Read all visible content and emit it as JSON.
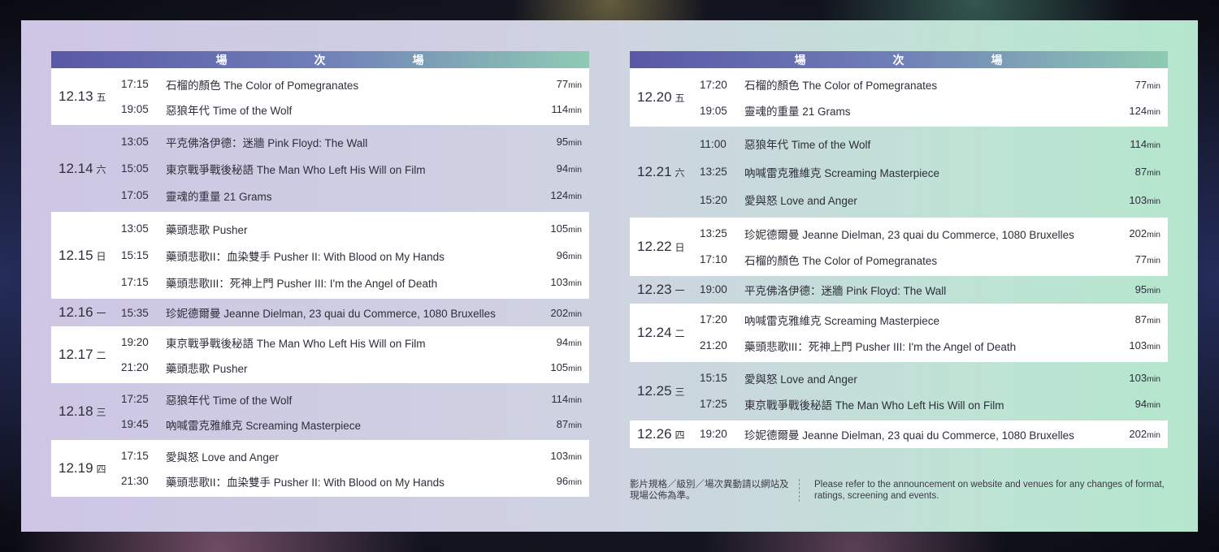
{
  "header": {
    "cells": [
      "場",
      "次",
      "場"
    ]
  },
  "unit": "min",
  "left": [
    {
      "date": "12.13",
      "weekday": "五",
      "bg": "white",
      "rows": [
        {
          "time": "17:15",
          "title": "石榴的顏色 The Color of Pomegranates",
          "dur": "77"
        },
        {
          "time": "19:05",
          "title": "惡狼年代 Time of the Wolf",
          "dur": "114"
        }
      ]
    },
    {
      "date": "12.14",
      "weekday": "六",
      "bg": "clear",
      "rows": [
        {
          "time": "13:05",
          "title": "平克佛洛伊德：迷牆 Pink Floyd: The Wall",
          "dur": "95"
        },
        {
          "time": "15:05",
          "title": "東京戰爭戰後秘語 The Man Who Left His Will on Film",
          "dur": "94"
        },
        {
          "time": "17:05",
          "title": "靈魂的重量 21 Grams",
          "dur": "124"
        }
      ]
    },
    {
      "date": "12.15",
      "weekday": "日",
      "bg": "white",
      "rows": [
        {
          "time": "13:05",
          "title": "藥頭悲歌 Pusher",
          "dur": "105"
        },
        {
          "time": "15:15",
          "title": "藥頭悲歌II：血染雙手 Pusher II: With Blood on My Hands",
          "dur": "96"
        },
        {
          "time": "17:15",
          "title": "藥頭悲歌III：死神上門 Pusher III: I'm the Angel of Death",
          "dur": "103"
        }
      ]
    },
    {
      "date": "12.16",
      "weekday": "一",
      "bg": "clear",
      "rows": [
        {
          "time": "15:35",
          "title": "珍妮德爾曼 Jeanne Dielman, 23 quai du Commerce, 1080 Bruxelles",
          "dur": "202"
        }
      ]
    },
    {
      "date": "12.17",
      "weekday": "二",
      "bg": "white",
      "rows": [
        {
          "time": "19:20",
          "title": "東京戰爭戰後秘語 The Man Who Left His Will on Film",
          "dur": "94"
        },
        {
          "time": "21:20",
          "title": "藥頭悲歌 Pusher",
          "dur": "105"
        }
      ]
    },
    {
      "date": "12.18",
      "weekday": "三",
      "bg": "clear",
      "rows": [
        {
          "time": "17:25",
          "title": "惡狼年代 Time of the Wolf",
          "dur": "114"
        },
        {
          "time": "19:45",
          "title": "吶喊雷克雅維克 Screaming Masterpiece",
          "dur": "87"
        }
      ]
    },
    {
      "date": "12.19",
      "weekday": "四",
      "bg": "white",
      "rows": [
        {
          "time": "17:15",
          "title": "愛與怒 Love and Anger",
          "dur": "103"
        },
        {
          "time": "21:30",
          "title": "藥頭悲歌II：血染雙手 Pusher II: With Blood on My Hands",
          "dur": "96"
        }
      ]
    }
  ],
  "right": [
    {
      "date": "12.20",
      "weekday": "五",
      "bg": "white",
      "rows": [
        {
          "time": "17:20",
          "title": "石榴的顏色 The Color of Pomegranates",
          "dur": "77"
        },
        {
          "time": "19:05",
          "title": "靈魂的重量 21 Grams",
          "dur": "124"
        }
      ]
    },
    {
      "date": "12.21",
      "weekday": "六",
      "bg": "clear",
      "rows": [
        {
          "time": "11:00",
          "title": "惡狼年代 Time of the Wolf",
          "dur": "114"
        },
        {
          "time": "13:25",
          "title": "吶喊雷克雅維克 Screaming Masterpiece",
          "dur": "87"
        },
        {
          "time": "15:20",
          "title": "愛與怒 Love and Anger",
          "dur": "103"
        }
      ]
    },
    {
      "date": "12.22",
      "weekday": "日",
      "bg": "white",
      "rows": [
        {
          "time": "13:25",
          "title": "珍妮德爾曼 Jeanne Dielman, 23 quai du Commerce, 1080 Bruxelles",
          "dur": "202"
        },
        {
          "time": "17:10",
          "title": "石榴的顏色 The Color of Pomegranates",
          "dur": "77"
        }
      ]
    },
    {
      "date": "12.23",
      "weekday": "一",
      "bg": "clear",
      "rows": [
        {
          "time": "19:00",
          "title": "平克佛洛伊德：迷牆 Pink Floyd: The Wall",
          "dur": "95"
        }
      ]
    },
    {
      "date": "12.24",
      "weekday": "二",
      "bg": "white",
      "rows": [
        {
          "time": "17:20",
          "title": "吶喊雷克雅維克 Screaming Masterpiece",
          "dur": "87"
        },
        {
          "time": "21:20",
          "title": "藥頭悲歌III：死神上門 Pusher III: I'm the Angel of Death",
          "dur": "103"
        }
      ]
    },
    {
      "date": "12.25",
      "weekday": "三",
      "bg": "clear",
      "rows": [
        {
          "time": "15:15",
          "title": "愛與怒 Love and Anger",
          "dur": "103"
        },
        {
          "time": "17:25",
          "title": "東京戰爭戰後秘語 The Man Who Left His Will on Film",
          "dur": "94"
        }
      ]
    },
    {
      "date": "12.26",
      "weekday": "四",
      "bg": "white",
      "rows": [
        {
          "time": "19:20",
          "title": "珍妮德爾曼 Jeanne Dielman, 23 quai du Commerce, 1080 Bruxelles",
          "dur": "202"
        }
      ]
    }
  ],
  "note": {
    "zh": "影片規格／級別／場次異動請以網站及現場公佈為準。",
    "en": "Please refer to the announcement on website and venues for any changes of format, ratings, screening and events."
  }
}
